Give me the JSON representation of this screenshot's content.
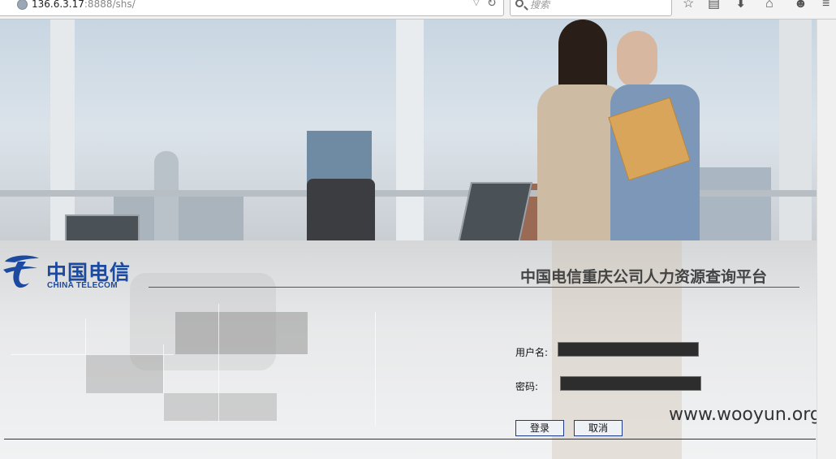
{
  "browser": {
    "url_host": "136.6.3.17",
    "url_rest": ":8888/shs/",
    "search_placeholder": "搜索",
    "icons": [
      "globe-icon",
      "dropdown-icon",
      "reload-icon",
      "search-icon",
      "star-icon",
      "bookmarks-icon",
      "download-icon",
      "home-icon",
      "smiley-icon",
      "menu-icon"
    ]
  },
  "brand": {
    "logo_cn": "中国电信",
    "logo_en": "CHINA TELECOM",
    "site_title": "中国电信重庆公司人力资源查询平台"
  },
  "login": {
    "username_label": "用户名:",
    "username_value": "",
    "password_label": "密码:",
    "password_value": "",
    "login_button": "登录",
    "cancel_button": "取消"
  },
  "watermark": "www.wooyun.org",
  "colors": {
    "brand_blue": "#1b4aa0",
    "field_bg": "#2d2d2d",
    "button_border": "#1e3a8a",
    "title_gray": "#444444"
  }
}
